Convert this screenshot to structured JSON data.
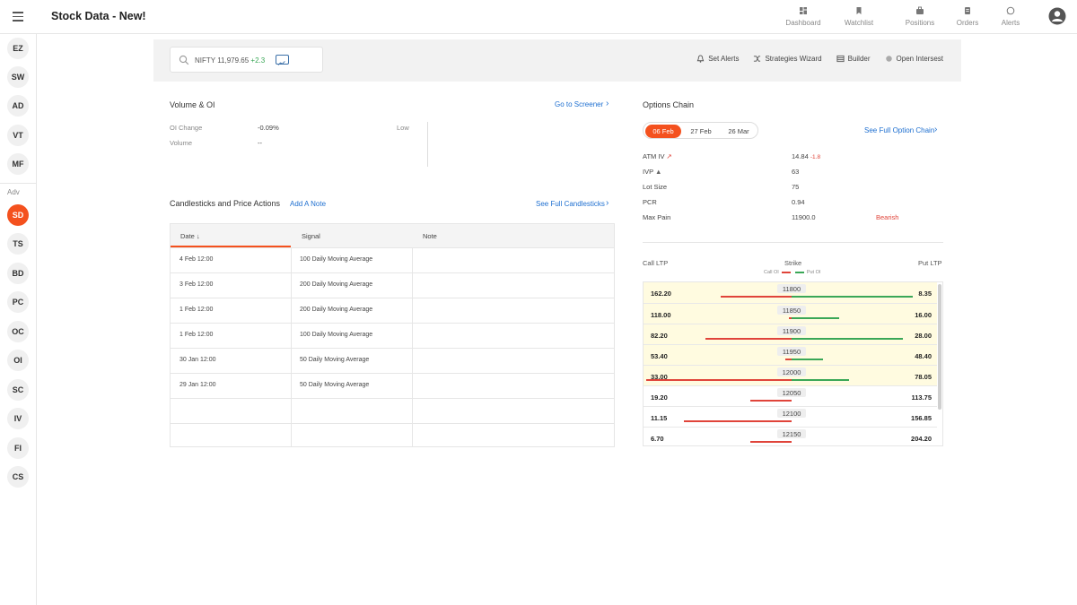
{
  "app": {
    "title": "Stock Data - New!"
  },
  "topnav": [
    {
      "label": "Dashboard",
      "icon": "dashboard-icon"
    },
    {
      "label": "Watchlist",
      "icon": "bookmark-icon"
    },
    {
      "label": "Positions",
      "icon": "briefcase-icon"
    },
    {
      "label": "Orders",
      "icon": "orders-icon"
    },
    {
      "label": "Alerts",
      "icon": "whatsapp-icon"
    }
  ],
  "sidebar": {
    "top_items": [
      "EZ",
      "SW",
      "AD",
      "VT",
      "MF"
    ],
    "adv_label": "Adv",
    "adv_items": [
      "SD",
      "TS",
      "BD",
      "PC",
      "OC",
      "OI",
      "SC",
      "IV",
      "FI",
      "CS"
    ],
    "active": "SD"
  },
  "search": {
    "symbol": "NIFTY 11,979.65",
    "change": "+2.3"
  },
  "toolbar": [
    "Set Alerts",
    "Strategies Wizard",
    "Builder",
    "Open Intersest"
  ],
  "volume_oi": {
    "title": "Volume & OI",
    "link": "Go to Screener",
    "oi_change_label": "OI Change",
    "oi_change_value": "-0.09%",
    "volume_label": "Volume",
    "volume_value": "--",
    "low_label": "Low"
  },
  "candlesticks": {
    "title": "Candlesticks and Price Actions",
    "add_note": "Add A Note",
    "link": "See Full Candlesticks",
    "columns": [
      "Date",
      "Signal",
      "Note"
    ],
    "rows": [
      {
        "date": "4 Feb 12:00",
        "signal": "100 Daily Moving Average",
        "note": ""
      },
      {
        "date": "3 Feb 12:00",
        "signal": "200 Daily Moving Average",
        "note": ""
      },
      {
        "date": "1 Feb 12:00",
        "signal": "200 Daily Moving Average",
        "note": ""
      },
      {
        "date": "1 Feb 12:00",
        "signal": "100 Daily Moving Average",
        "note": ""
      },
      {
        "date": "30 Jan 12:00",
        "signal": "50 Daily Moving Average",
        "note": ""
      },
      {
        "date": "29 Jan 12:00",
        "signal": "50 Daily Moving Average",
        "note": ""
      },
      {
        "date": "",
        "signal": "",
        "note": ""
      },
      {
        "date": "",
        "signal": "",
        "note": ""
      }
    ]
  },
  "options_chain": {
    "title": "Options Chain",
    "expiries": [
      "06 Feb",
      "27 Feb",
      "26 Mar"
    ],
    "active_expiry": "06 Feb",
    "link": "See Full Option Chain",
    "stats": {
      "atm_iv_label": "ATM IV",
      "atm_iv_value": "14.84",
      "atm_iv_change": "-1.8",
      "ivp_label": "IVP",
      "ivp_value": "63",
      "lot_label": "Lot Size",
      "lot_value": "75",
      "pcr_label": "PCR",
      "pcr_value": "0.94",
      "maxpain_label": "Max Pain",
      "maxpain_value": "11900.0",
      "maxpain_signal": "Bearish"
    },
    "headers": {
      "call": "Call LTP",
      "strike": "Strike",
      "put": "Put LTP",
      "legend_call": "Call OI",
      "legend_put": "Put OI"
    },
    "colors": {
      "call_oi": "#e0443a",
      "put_oi": "#3aa757",
      "itm_row": "#fffbe0",
      "accent": "#f4511e",
      "link": "#1e6fd0"
    },
    "rows": [
      {
        "call": "162.20",
        "strike": "11800",
        "put": "8.35",
        "call_oi": 0.48,
        "put_oi": 0.82,
        "itm": true
      },
      {
        "call": "118.00",
        "strike": "11850",
        "put": "16.00",
        "call_oi": 0.02,
        "put_oi": 0.32,
        "itm": true
      },
      {
        "call": "82.20",
        "strike": "11900",
        "put": "28.00",
        "call_oi": 0.58,
        "put_oi": 0.75,
        "itm": true
      },
      {
        "call": "53.40",
        "strike": "11950",
        "put": "48.40",
        "call_oi": 0.04,
        "put_oi": 0.21,
        "itm": true
      },
      {
        "call": "33.00",
        "strike": "12000",
        "put": "78.05",
        "call_oi": 0.98,
        "put_oi": 0.39,
        "itm": true
      },
      {
        "call": "19.20",
        "strike": "12050",
        "put": "113.75",
        "call_oi": 0.28,
        "put_oi": 0.0,
        "itm": false
      },
      {
        "call": "11.15",
        "strike": "12100",
        "put": "156.85",
        "call_oi": 0.73,
        "put_oi": 0.0,
        "itm": false
      },
      {
        "call": "6.70",
        "strike": "12150",
        "put": "204.20",
        "call_oi": 0.28,
        "put_oi": 0.0,
        "itm": false
      }
    ]
  }
}
